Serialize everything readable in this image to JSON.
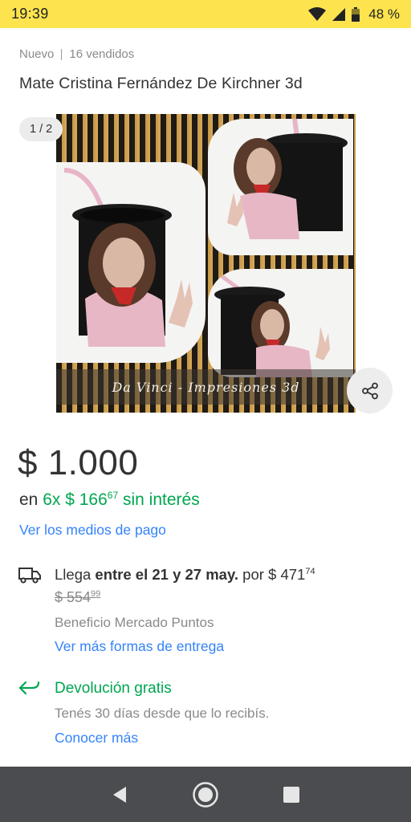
{
  "status_bar": {
    "time": "19:39",
    "battery": "48 %",
    "icons": [
      "wifi-icon",
      "signal-icon",
      "battery-icon"
    ]
  },
  "product": {
    "condition": "Nuevo",
    "sold": "16 vendidos",
    "title": "Mate Cristina Fernández De Kirchner 3d"
  },
  "gallery": {
    "page_indicator": "1 / 2",
    "watermark": "Da Vinci - Impresiones 3d",
    "share_icon": "share-icon"
  },
  "pricing": {
    "price": "$ 1.000",
    "installments_prefix": "en",
    "installments_count": "6x $ 166",
    "installments_cents": "67",
    "installments_suffix": "sin interés",
    "payment_link": "Ver los medios de pago"
  },
  "shipping": {
    "prefix": "Llega",
    "dates": "entre el 21 y 27 may.",
    "by": "por $ 471",
    "by_cents": "74",
    "old_price": "$ 554",
    "old_price_cents": "99",
    "benefit": "Beneficio Mercado Puntos",
    "link": "Ver más formas de entrega"
  },
  "returns": {
    "title": "Devolución gratis",
    "description": "Tenés 30 días desde que lo recibís.",
    "link": "Conocer más"
  },
  "colors": {
    "status_bar": "#fde44f",
    "green": "#00a650",
    "link_blue": "#3483fa",
    "nav_bar": "#4a4c4f"
  }
}
